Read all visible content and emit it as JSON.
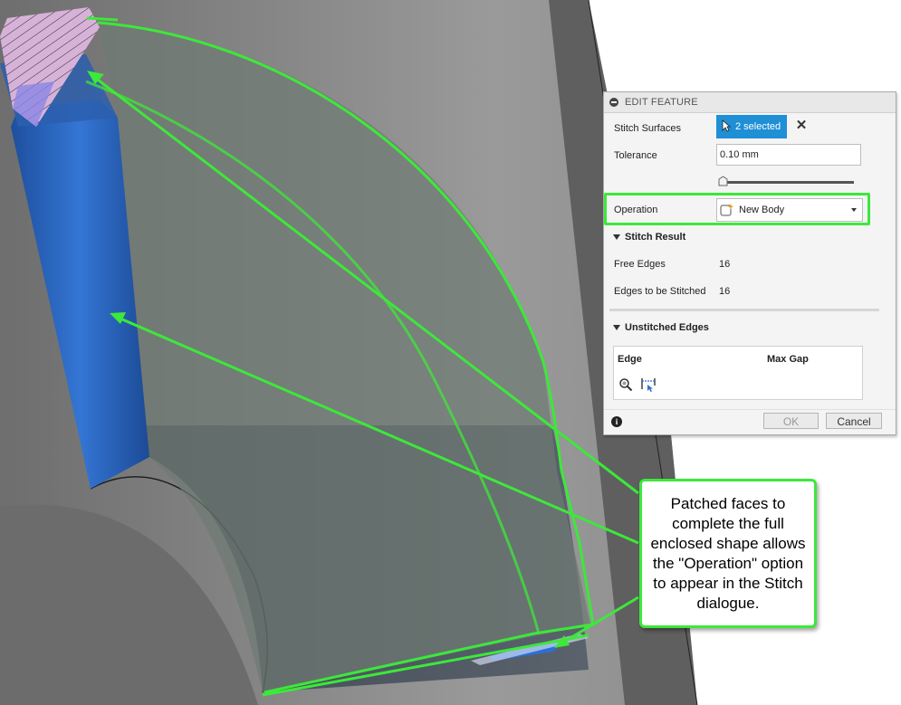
{
  "dialog": {
    "title": "EDIT FEATURE",
    "stitch_surfaces": {
      "label": "Stitch Surfaces",
      "value": "2 selected"
    },
    "tolerance": {
      "label": "Tolerance",
      "value": "0.10 mm"
    },
    "operation": {
      "label": "Operation",
      "value": "New Body"
    },
    "stitch_result": {
      "title": "Stitch Result",
      "free_edges": {
        "label": "Free Edges",
        "value": "16"
      },
      "edges_to_stitch": {
        "label": "Edges to be Stitched",
        "value": "16"
      }
    },
    "unstitched_edges": {
      "title": "Unstitched Edges",
      "columns": [
        "Edge",
        "Max Gap"
      ]
    },
    "ok_label": "OK",
    "cancel_label": "Cancel"
  },
  "callout": {
    "text": "Patched faces to complete the full enclosed shape allows the \"Operation\" option to appear in the Stitch dialogue."
  },
  "colors": {
    "highlight_green": "#3de83a",
    "selection_blue": "#1f8fd6",
    "face_blue": "#2f6fce"
  }
}
